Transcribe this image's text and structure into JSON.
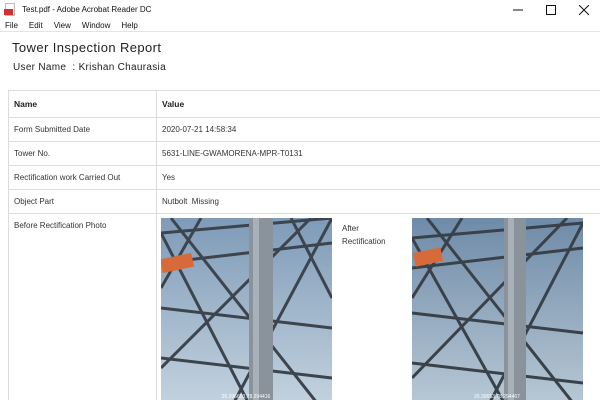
{
  "window": {
    "title": "Test.pdf - Adobe Acrobat Reader DC",
    "icon": "pdf-file-icon"
  },
  "menu": {
    "items": [
      "File",
      "Edit",
      "View",
      "Window",
      "Help"
    ]
  },
  "report": {
    "title": "Tower Inspection Report",
    "user_label": "User Name",
    "user_sep": ":",
    "user_name": "Krishan Chaurasia",
    "user_line": "User Name  : Krishan Chaurasia"
  },
  "table": {
    "headers": [
      "Name",
      "Value"
    ],
    "rows": [
      {
        "name": "Form Submitted Date",
        "value": "2020-07-21 14:58:34"
      },
      {
        "name": "Tower No.",
        "value": "5631-LINE-GWAMORENA-MPR-T0131"
      },
      {
        "name": "Rectification work Carried Out",
        "value": "Yes"
      },
      {
        "name": "Object Part",
        "value": "Nutbolt  Missing"
      }
    ],
    "photo_row": {
      "label": "Before Rectification Photo",
      "after_label": "After Rectification",
      "before_coords": "26.396603,78.294416",
      "after_coords": "26.39653,78.294467"
    }
  },
  "colors": {
    "border": "#dcdcdc",
    "sky": "#9fb7cd",
    "steel": "#6b7480",
    "banner": "#d66a3a"
  }
}
